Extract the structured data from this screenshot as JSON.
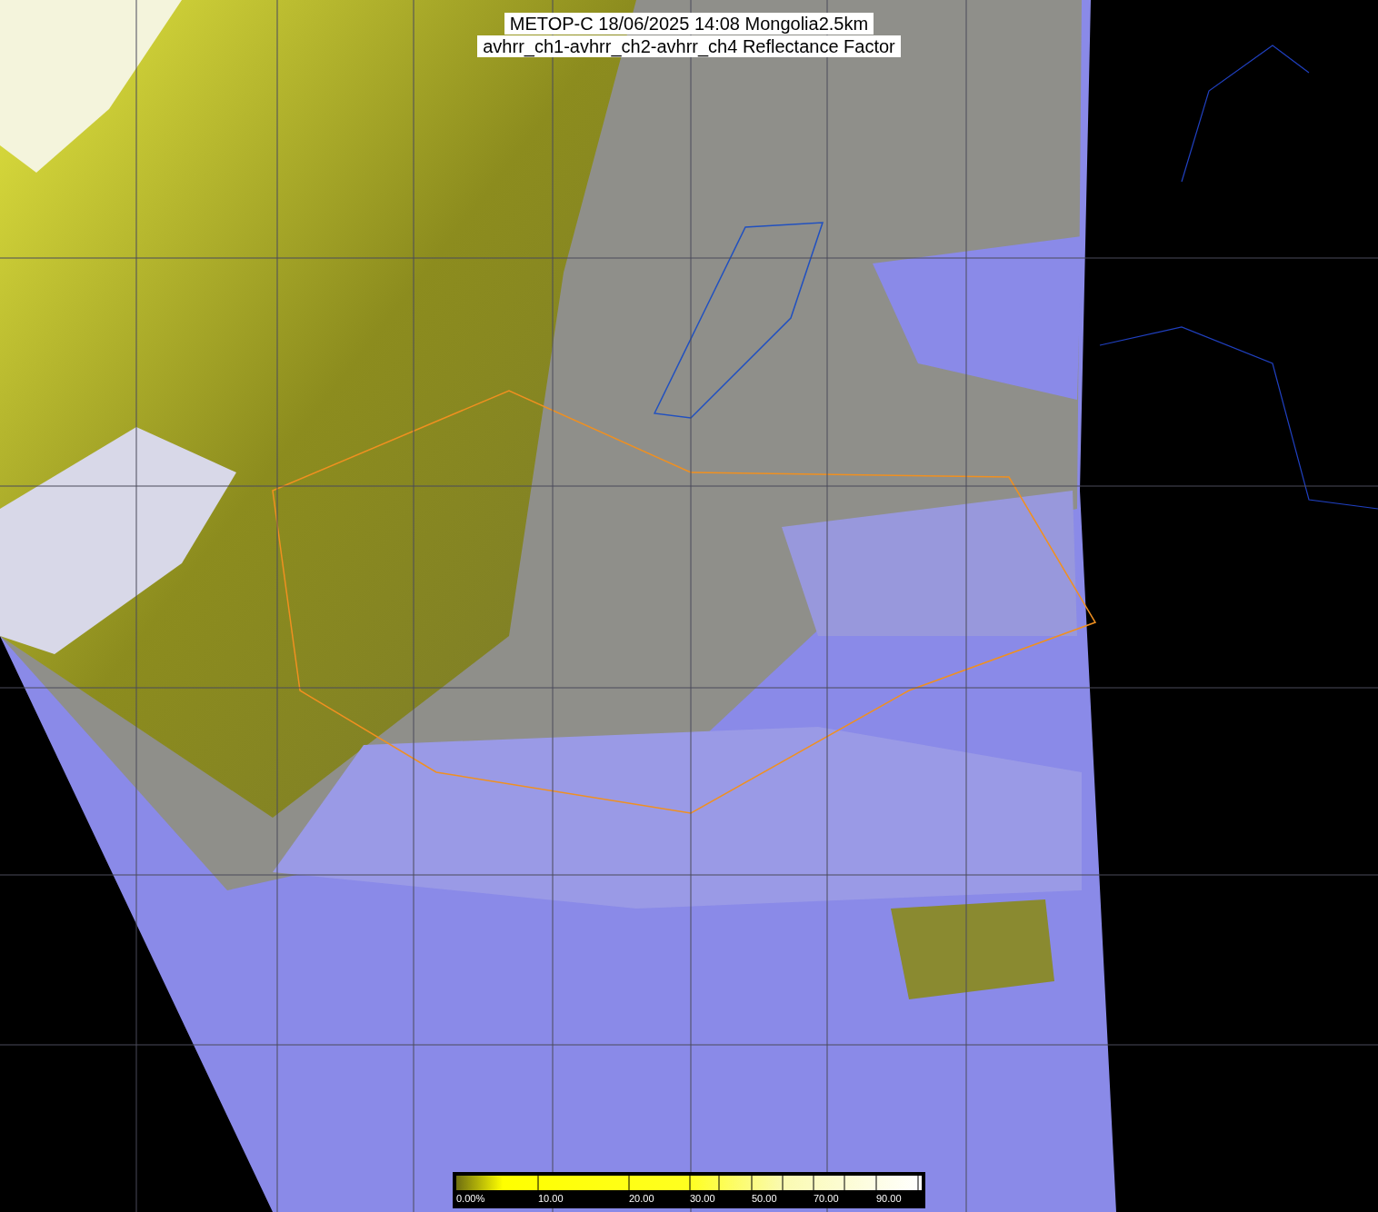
{
  "title": {
    "lines": [
      "METOP-C 18/06/2025 14:08 Mongolia2.5km",
      "avhrr_ch1-avhrr_ch2-avhrr_ch4 Reflectance Factor"
    ]
  },
  "colorbar": {
    "labels": [
      "0.00%",
      "10.00",
      "20.00",
      "30.00",
      "50.00",
      "70.00",
      "90.00"
    ]
  }
}
